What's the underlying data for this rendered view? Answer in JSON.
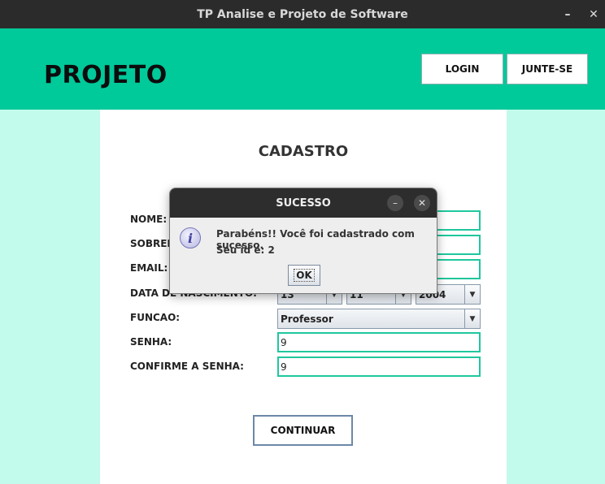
{
  "window": {
    "title": "TP Analise e Projeto de Software",
    "minimize": "–",
    "close": "✕"
  },
  "header": {
    "brand": "PROJETO",
    "login": "LOGIN",
    "join": "JUNTE-SE"
  },
  "form": {
    "title": "CADASTRO",
    "labels": {
      "nome": "NOME:",
      "sobrenome": "SOBRENOME:",
      "email": "EMAIL:",
      "data": "DATA DE NASCIMENTO:",
      "funcao": "FUNCAO:",
      "senha": "SENHA:",
      "confirme": "CONFIRME A SENHA:"
    },
    "values": {
      "dia": "13",
      "mes": "11",
      "ano": "2004",
      "funcao": "Professor",
      "senha": "9",
      "confirme": "9"
    },
    "continue": "CONTINUAR"
  },
  "dialog": {
    "title": "SUCESSO",
    "line1": "Parabéns!! Você foi cadastrado com sucesso.",
    "line2": "Seu id é: 2",
    "ok": "OK",
    "icon": "info-icon",
    "minimize": "–",
    "close": "✕"
  }
}
